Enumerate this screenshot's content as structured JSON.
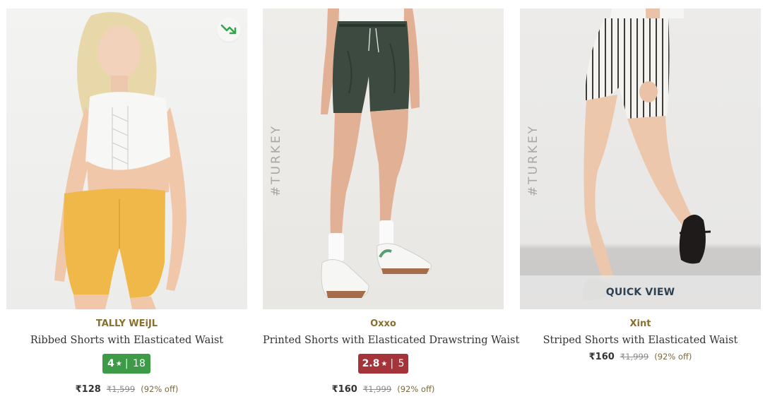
{
  "products": [
    {
      "brand": "TALLY WEiJL",
      "name": "Ribbed Shorts with Elasticated Waist",
      "rating": {
        "value": "4",
        "star": "★",
        "separator": "|",
        "count": "18",
        "color": "#3d9b47"
      },
      "price": "₹128",
      "mrp": "₹1,599",
      "discount": "(92% off)",
      "trend_icon": "trending-down-icon",
      "image": "Model in white lace-up crop top and yellow ribbed shorts"
    },
    {
      "brand": "Oxxo",
      "name": "Printed Shorts with Elasticated Drawstring Waist",
      "rating": {
        "value": "2.8",
        "star": "★",
        "separator": "|",
        "count": "5",
        "color": "#a5333a"
      },
      "price": "₹160",
      "mrp": "₹1,999",
      "discount": "(92% off)",
      "image_tag": "#TURKEY",
      "image": "Model in dark green shorts with white sneakers"
    },
    {
      "brand": "Xint",
      "name": "Striped Shorts with Elasticated Waist",
      "price": "₹160",
      "mrp": "₹1,999",
      "discount": "(92% off)",
      "image_tag": "#TURKEY",
      "quick_view_label": "QUICK VIEW",
      "image": "Model in white striped shorts with black heels"
    }
  ],
  "colors": {
    "brand_text": "#8a6e2b",
    "rating_good": "#3d9b47",
    "rating_poor": "#a5333a",
    "quick_view_text": "#2c4152"
  }
}
